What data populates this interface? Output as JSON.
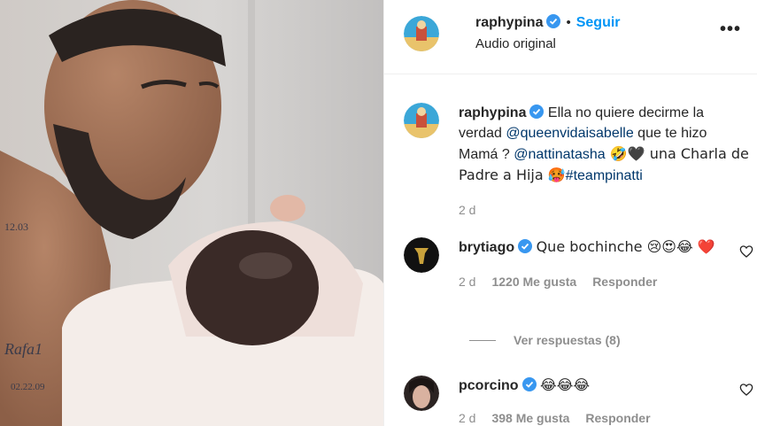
{
  "header": {
    "username": "raphypina",
    "follow_label": "Seguir",
    "separator": "•",
    "subtitle": "Audio original",
    "more_label": "•••"
  },
  "caption": {
    "username": "raphypina",
    "text_1": "Ella no quiere decirme la verdad ",
    "mention_1": "@queenvidaisabelle",
    "text_2": " que te hizo Mamá ? ",
    "mention_2": "@nattinatasha",
    "text_3": " 🤣🖤 una Charla de Padre a Hija 🥵",
    "hashtag": "#teampinatti",
    "time": "2 d"
  },
  "comments": [
    {
      "username": "brytiago",
      "text": "Que bochinche 😢😍😂 ❤️",
      "time": "2 d",
      "likes": "1220 Me gusta",
      "reply_label": "Responder"
    },
    {
      "username": "pcorcino",
      "text": "😂😂😂",
      "time": "2 d",
      "likes": "398 Me gusta",
      "reply_label": "Responder"
    }
  ],
  "replies_label": "Ver respuestas (8)",
  "colors": {
    "link": "#0095f6",
    "mention": "#00376b",
    "muted": "#8e8e8e",
    "verified": "#3897f0"
  },
  "icons": {
    "verified": "verified-badge-icon",
    "heart": "heart-outline-icon",
    "more": "more-options-icon"
  }
}
